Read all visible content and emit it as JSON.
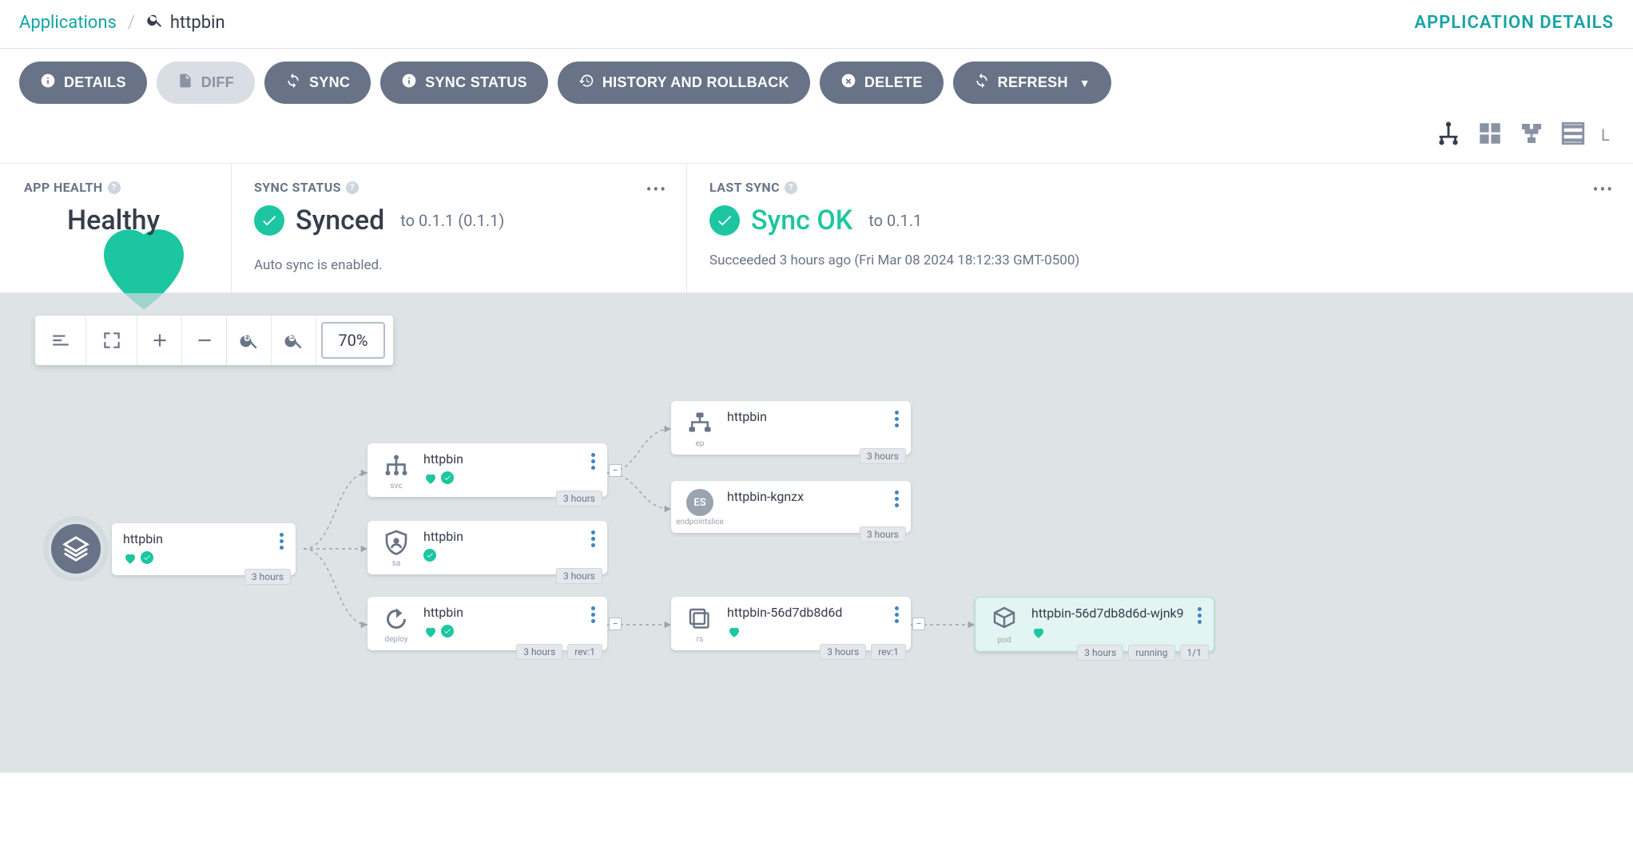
{
  "breadcrumb": {
    "root": "Applications",
    "current": "httpbin"
  },
  "page_title": "APPLICATION DETAILS",
  "actions": {
    "details": "DETAILS",
    "diff": "DIFF",
    "sync": "SYNC",
    "sync_status": "SYNC STATUS",
    "history": "HISTORY AND ROLLBACK",
    "delete": "DELETE",
    "refresh": "REFRESH"
  },
  "view_label_cut": "L",
  "health": {
    "label": "APP HEALTH",
    "value": "Healthy"
  },
  "sync_status": {
    "label": "SYNC STATUS",
    "value": "Synced",
    "version": "to 0.1.1 (0.1.1)",
    "note": "Auto sync is enabled."
  },
  "last_sync": {
    "label": "LAST SYNC",
    "value": "Sync OK",
    "version": "to 0.1.1",
    "detail": "Succeeded 3 hours ago (Fri Mar 08 2024 18:12:33 GMT-0500)"
  },
  "zoom": "70%",
  "tree": {
    "root": {
      "name": "httpbin",
      "age": "3 hours"
    },
    "svc": {
      "kind": "svc",
      "name": "httpbin",
      "age": "3 hours"
    },
    "sa": {
      "kind": "sa",
      "name": "httpbin",
      "age": "3 hours"
    },
    "deploy": {
      "kind": "deploy",
      "name": "httpbin",
      "age": "3 hours",
      "rev": "rev:1"
    },
    "ep": {
      "kind": "ep",
      "name": "httpbin",
      "age": "3 hours"
    },
    "es": {
      "kind": "endpointslice",
      "badge": "ES",
      "name": "httpbin-kgnzx",
      "age": "3 hours"
    },
    "rs": {
      "kind": "rs",
      "name": "httpbin-56d7db8d6d",
      "age": "3 hours",
      "rev": "rev:1"
    },
    "pod": {
      "kind": "pod",
      "name": "httpbin-56d7db8d6d-wjnk9",
      "age": "3 hours",
      "state": "running",
      "ready": "1/1"
    }
  }
}
